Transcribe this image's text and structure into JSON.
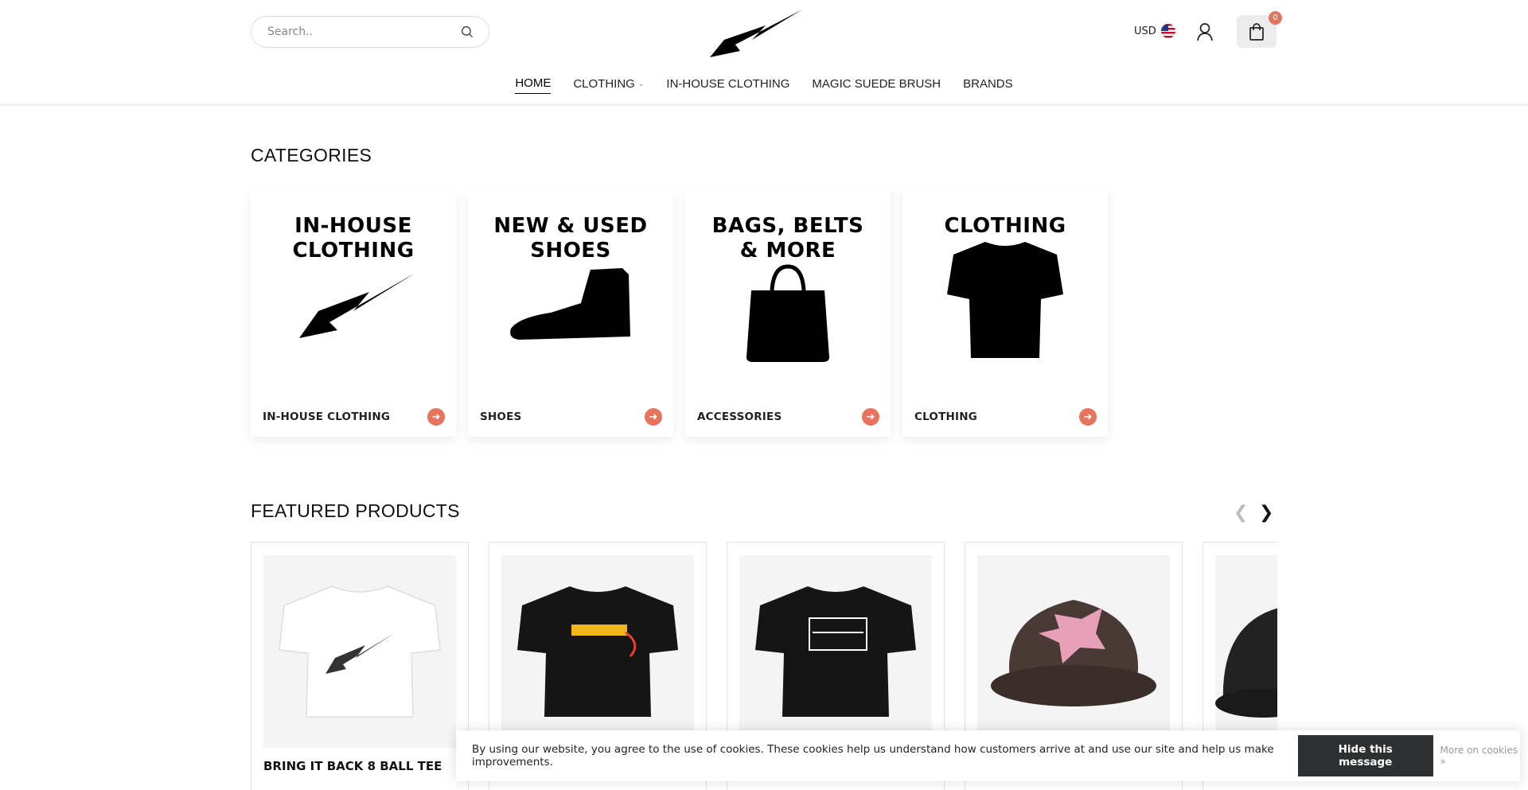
{
  "header": {
    "search_placeholder": "Search..",
    "currency": "USD",
    "cart_count": "0"
  },
  "nav": [
    {
      "label": "HOME",
      "active": true
    },
    {
      "label": "CLOTHING",
      "dropdown": true
    },
    {
      "label": "IN-HOUSE CLOTHING"
    },
    {
      "label": "MAGIC SUEDE BRUSH"
    },
    {
      "label": "BRANDS"
    }
  ],
  "categories": {
    "title": "CATEGORIES",
    "items": [
      {
        "art_text": "IN-HOUSE CLOTHING",
        "label": "IN-HOUSE CLOTHING"
      },
      {
        "art_text": "NEW & USED SHOES",
        "label": "SHOES"
      },
      {
        "art_text": "BAGS, BELTS & MORE",
        "label": "ACCESSORIES"
      },
      {
        "art_text": "CLOTHING",
        "label": "CLOTHING"
      }
    ]
  },
  "featured": {
    "title": "FEATURED PRODUCTS",
    "products": [
      {
        "name": "BRING IT BACK 8 BALL TEE"
      },
      {
        "name": ""
      },
      {
        "name": ""
      },
      {
        "name": ""
      },
      {
        "name": ""
      }
    ]
  },
  "cookie": {
    "message": "By using our website, you agree to the use of cookies. These cookies help us understand how customers arrive at and use our site and help us make improvements.",
    "hide_label": "Hide this message",
    "more_label": "More on cookies »"
  },
  "colors": {
    "accent": "#e8735c",
    "dark_button": "#2e3032"
  }
}
